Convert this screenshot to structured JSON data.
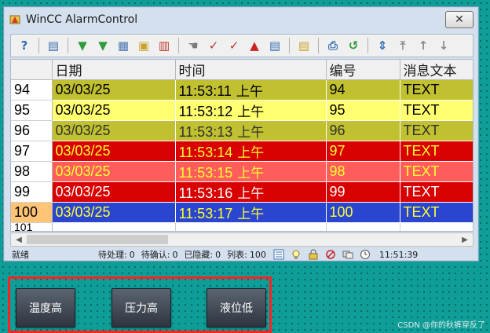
{
  "window": {
    "title": "WinCC AlarmControl",
    "close_label": "✕"
  },
  "toolbar": {
    "buttons": [
      {
        "name": "help-icon",
        "glyph": "?",
        "color": "#2f6db3"
      },
      {
        "name": "config-dialog-icon",
        "glyph": "▤",
        "color": "#3a6fb0"
      },
      {
        "name": "message-list-icon",
        "glyph": "▼",
        "color": "#2e9a3a"
      },
      {
        "name": "historical-list-icon",
        "glyph": "▼",
        "color": "#2e9a3a"
      },
      {
        "name": "archive-icon",
        "glyph": "▦",
        "color": "#4a78b0"
      },
      {
        "name": "lock-list-icon",
        "glyph": "▣",
        "color": "#c9a227"
      },
      {
        "name": "statistics-icon",
        "glyph": "▥",
        "color": "#c03a2b"
      },
      {
        "name": "loop-in-alarm-icon",
        "glyph": "☚",
        "color": "#7a7a7a"
      },
      {
        "name": "single-ack-icon",
        "glyph": "✓",
        "color": "#c0392b"
      },
      {
        "name": "group-ack-icon",
        "glyph": "✓",
        "color": "#c0392b"
      },
      {
        "name": "horn-ack-icon",
        "glyph": "▲",
        "color": "#cc2222"
      },
      {
        "name": "emergency-ack-icon",
        "glyph": "▤",
        "color": "#3a6fb0"
      },
      {
        "name": "selection-dialog-icon",
        "glyph": "▤",
        "color": "#c9a227"
      },
      {
        "name": "print-icon",
        "glyph": "⎙",
        "color": "#3a6fb0"
      },
      {
        "name": "autoscroll-icon",
        "glyph": "↺",
        "color": "#2e9a3a"
      },
      {
        "name": "sort-icon",
        "glyph": "⇕",
        "color": "#2f6db3"
      },
      {
        "name": "first-message-icon",
        "glyph": "⤒",
        "color": "#8a8a8a"
      },
      {
        "name": "previous-message-icon",
        "glyph": "↑",
        "color": "#8a8a8a"
      },
      {
        "name": "next-message-icon",
        "glyph": "↓",
        "color": "#8a8a8a"
      }
    ]
  },
  "table": {
    "columns": [
      "日期",
      "时间",
      "编号",
      "消息文本"
    ],
    "rows": [
      {
        "num": "94",
        "date": "03/03/25",
        "time": "11:53:11",
        "ampm": "上午",
        "id": "94",
        "text": "TEXT",
        "bg": "#c0c030",
        "fg": "#000000",
        "highlight": false
      },
      {
        "num": "95",
        "date": "03/03/25",
        "time": "11:53:12",
        "ampm": "上午",
        "id": "95",
        "text": "TEXT",
        "bg": "#ffff70",
        "fg": "#000000",
        "highlight": false
      },
      {
        "num": "96",
        "date": "03/03/25",
        "time": "11:53:13",
        "ampm": "上午",
        "id": "96",
        "text": "TEXT",
        "bg": "#c0c030",
        "fg": "#303030",
        "highlight": false
      },
      {
        "num": "97",
        "date": "03/03/25",
        "time": "11:53:14",
        "ampm": "上午",
        "id": "97",
        "text": "TEXT",
        "bg": "#d80000",
        "fg": "#ffff30",
        "highlight": false
      },
      {
        "num": "98",
        "date": "03/03/25",
        "time": "11:53:15",
        "ampm": "上午",
        "id": "98",
        "text": "TEXT",
        "bg": "#ff5c5c",
        "fg": "#ffff30",
        "highlight": false
      },
      {
        "num": "99",
        "date": "03/03/25",
        "time": "11:53:16",
        "ampm": "上午",
        "id": "99",
        "text": "TEXT",
        "bg": "#d80000",
        "fg": "#ffffff",
        "highlight": false
      },
      {
        "num": "100",
        "date": "03/03/25",
        "time": "11:53:17",
        "ampm": "上午",
        "id": "100",
        "text": "TEXT",
        "bg": "#2a45d0",
        "fg": "#ffff30",
        "highlight": true
      }
    ],
    "partial_row_num": "101"
  },
  "status": {
    "ready": "就绪",
    "pending_label": "待处理:",
    "pending_value": "0",
    "to_ack_label": "待确认:",
    "to_ack_value": "0",
    "hidden_label": "已隐藏:",
    "hidden_value": "0",
    "list_label": "列表:",
    "list_value": "100",
    "time": "11:51:39"
  },
  "buttons": {
    "temp_high": "温度高",
    "pressure_high": "压力高",
    "level_low": "液位低"
  },
  "watermark": "CSDN @你的秋裤穿反了",
  "colors": {
    "background": "#0f9d97",
    "panel_border": "#ff2020",
    "row_highlight": "#ffc476"
  }
}
